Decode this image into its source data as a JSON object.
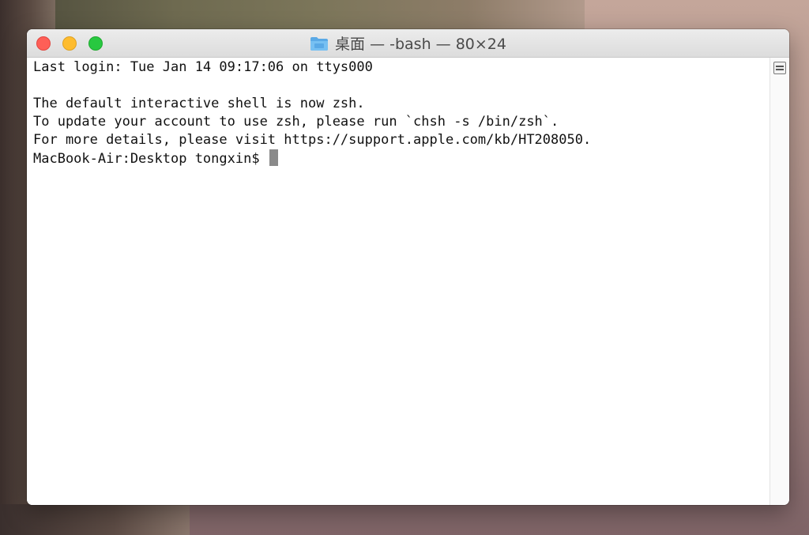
{
  "window": {
    "title": "桌面 — -bash — 80×24",
    "title_icon": "folder-icon"
  },
  "terminal": {
    "lines": [
      "Last login: Tue Jan 14 09:17:06 on ttys000",
      "",
      "The default interactive shell is now zsh.",
      "To update your account to use zsh, please run `chsh -s /bin/zsh`.",
      "For more details, please visit https://support.apple.com/kb/HT208050.",
      "MacBook-Air:Desktop tongxin$ "
    ]
  },
  "colors": {
    "close": "#fe5f57",
    "minimize": "#febc2e",
    "maximize": "#28c840",
    "text": "#111111",
    "cursor": "#8a8a8a"
  }
}
